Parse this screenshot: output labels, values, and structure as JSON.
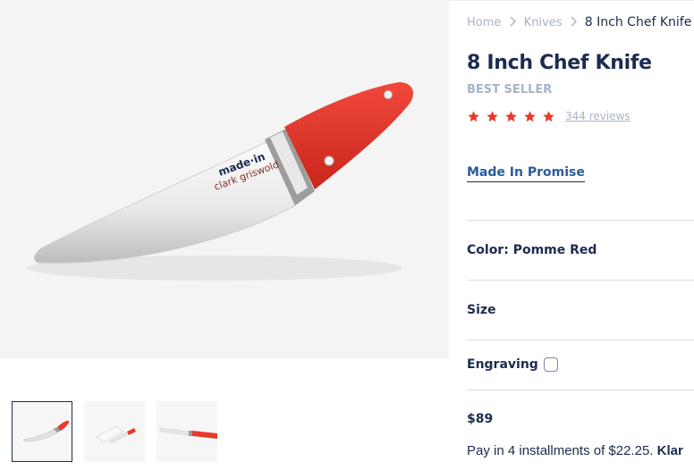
{
  "breadcrumb": {
    "home": "Home",
    "category": "Knives",
    "current": "8 Inch Chef Knife"
  },
  "product": {
    "title": "8 Inch Chef Knife",
    "badge": "BEST SELLER",
    "rating": 5,
    "rating_max": 5,
    "reviews_label": "344 reviews",
    "promise_link": "Made In Promise",
    "blade_brand": "made·in",
    "blade_collab": "clark griswold"
  },
  "options": {
    "color_label": "Color: Pomme Red",
    "size_label": "Size",
    "engraving_label": "Engraving",
    "engraving_checked": false
  },
  "pricing": {
    "price": "$89",
    "installments_text": "Pay in 4 installments of $22.25.",
    "provider": "Klar"
  },
  "colors": {
    "accent_red": "#e8392d",
    "navy": "#1d2b4f",
    "muted": "#a8b2c8",
    "link_blue": "#2a5b9c"
  },
  "thumbnails": [
    {
      "name": "thumb-knife-front",
      "active": true
    },
    {
      "name": "thumb-knife-packaging",
      "active": false
    },
    {
      "name": "thumb-knife-side",
      "active": false
    }
  ]
}
